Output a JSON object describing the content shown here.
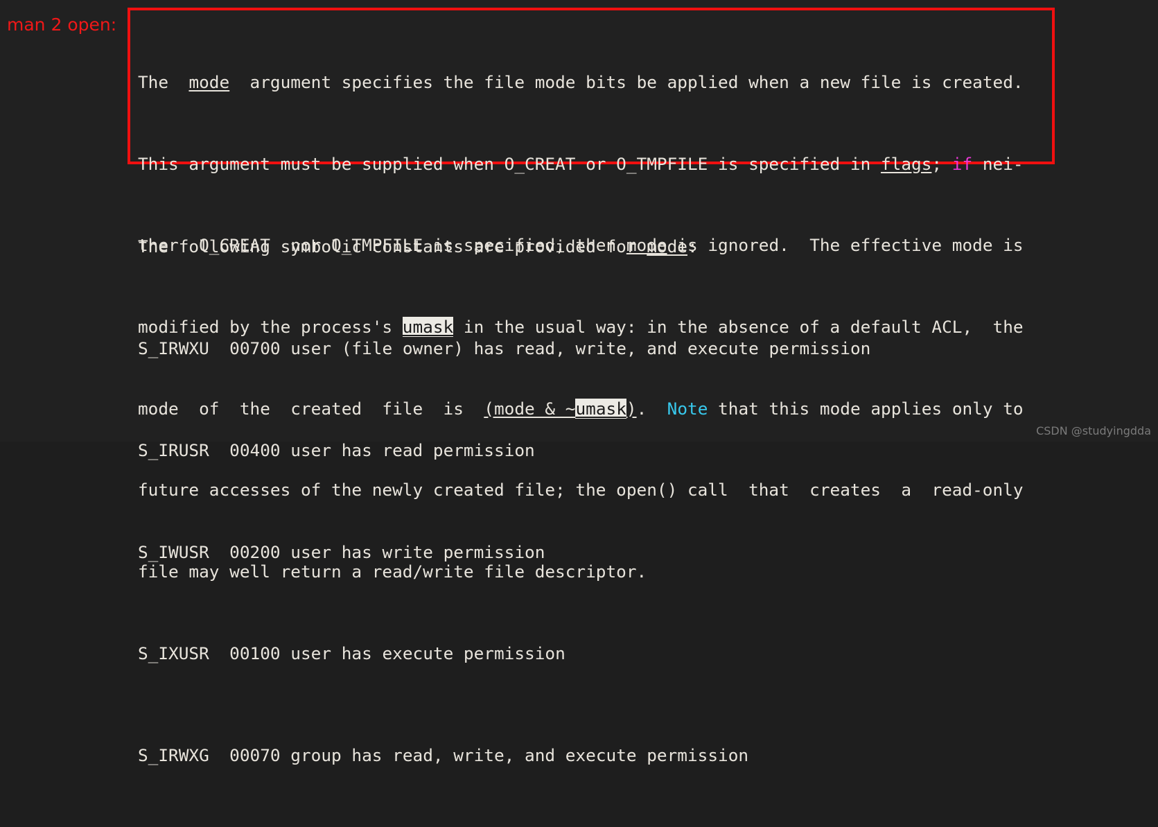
{
  "annotation": {
    "label": "man 2 open:",
    "box_color": "#f01010",
    "label_color": "#f01818"
  },
  "terminal": {
    "background": "#212121",
    "foreground": "#e8e4dc",
    "highlight_bg": "#eceae4",
    "magenta": "#ec38d8",
    "cyan": "#38c8ec",
    "paragraph": {
      "line1": {
        "a": "The  ",
        "mode": "mode",
        "b": "  argument specifies the file mode bits be applied when a new file is created."
      },
      "line2": {
        "a": "This argument must be supplied when O_CREAT or O_TMPFILE is specified in ",
        "flags": "flags",
        "b": "; ",
        "if": "if",
        "c": " nei-"
      },
      "line3": {
        "a": "ther  O_CREAT  nor O_TMPFILE is specified, then ",
        "mode": "mode",
        "b": " is ignored.  The effective mode is"
      },
      "line4": {
        "a": "modified by the process's ",
        "umask": "umask",
        "b": " in the usual way: in the absence of a default ACL,  the"
      },
      "line5": {
        "a": "mode  of  the  created  file  is  ",
        "expr_open": "(mode & ~",
        "umask": "umask",
        "expr_close": ")",
        "b": ".  ",
        "note": "Note",
        "c": " that this mode applies only to"
      },
      "line6": {
        "a": "future accesses of the newly created file; the open() call  that  creates  a  read-only"
      },
      "line7": {
        "a": "file may well return a read/write file descriptor."
      }
    },
    "intro": {
      "a": "The following symbolic constants are provided for ",
      "mode": "mode",
      "b": ":"
    },
    "constants": [
      {
        "name": "S_IRWXU",
        "octal": "00700",
        "description": "user (file owner) has read, write, and execute permission"
      },
      {
        "name": "S_IRUSR",
        "octal": "00400",
        "description": "user has read permission"
      },
      {
        "name": "S_IWUSR",
        "octal": "00200",
        "description": "user has write permission"
      },
      {
        "name": "S_IXUSR",
        "octal": "00100",
        "description": "user has execute permission"
      },
      {
        "name": "S_IRWXG",
        "octal": "00070",
        "description": "group has read, write, and execute permission"
      }
    ]
  },
  "watermark": {
    "text": "CSDN @studyingdda"
  }
}
